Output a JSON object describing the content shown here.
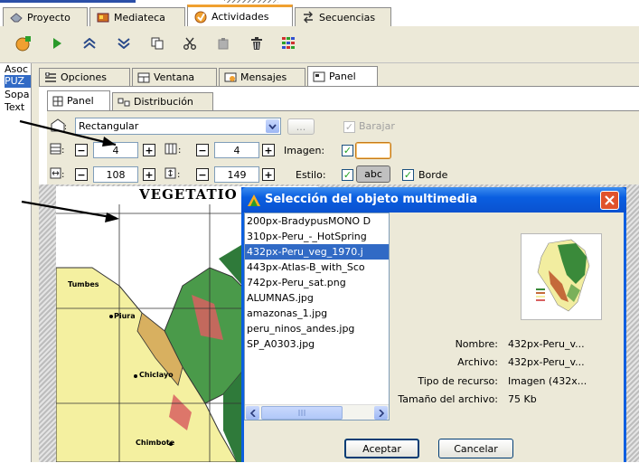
{
  "top_tabs": [
    {
      "label": "Proyecto"
    },
    {
      "label": "Mediateca"
    },
    {
      "label": "Actividades"
    },
    {
      "label": "Secuencias"
    }
  ],
  "left_list": [
    "Asoc",
    "PUZ",
    "Sopa",
    "Text"
  ],
  "sub_tabs": [
    {
      "label": "Opciones"
    },
    {
      "label": "Ventana"
    },
    {
      "label": "Mensajes"
    },
    {
      "label": "Panel"
    }
  ],
  "inner_tabs": [
    {
      "label": "Panel"
    },
    {
      "label": "Distribución"
    }
  ],
  "panel": {
    "shape_value": "Rectangular",
    "shape_more_label": "...",
    "shuffle_label": "Barajar",
    "rows_value": "4",
    "cols_value": "4",
    "image_label": "Imagen:",
    "width_value": "108",
    "height_value": "149",
    "style_label": "Estilo:",
    "style_button": "abc",
    "border_label": "Borde"
  },
  "map": {
    "title": "VEGETATIO",
    "places": [
      "Tumbes",
      "Piura",
      "Chiclayo",
      "Chimbote"
    ]
  },
  "dialog": {
    "title": "Selección del objeto multimedia",
    "files": [
      "200px-BradypusMONO D",
      "310px-Peru_-_HotSpring",
      "432px-Peru_veg_1970.j",
      "443px-Atlas-B_with_Sco",
      "742px-Peru_sat.png",
      "ALUMNAS.jpg",
      "amazonas_1.jpg",
      "peru_ninos_andes.jpg",
      "SP_A0303.jpg"
    ],
    "selected_index": 2,
    "props": [
      {
        "label": "Nombre:",
        "value": "432px-Peru_v..."
      },
      {
        "label": "Archivo:",
        "value": "432px-Peru_v..."
      },
      {
        "label": "Tipo de recurso:",
        "value": "Imagen (432x..."
      },
      {
        "label": "Tamaño del archivo:",
        "value": "75 Kb"
      }
    ],
    "accept_label": "Aceptar",
    "cancel_label": "Cancelar"
  },
  "colors": {
    "accent": "#f0a030",
    "dialog_titlebar": "#0a5ee0",
    "selection": "#316ac5",
    "check": "#21a121",
    "close": "#e0522c"
  }
}
